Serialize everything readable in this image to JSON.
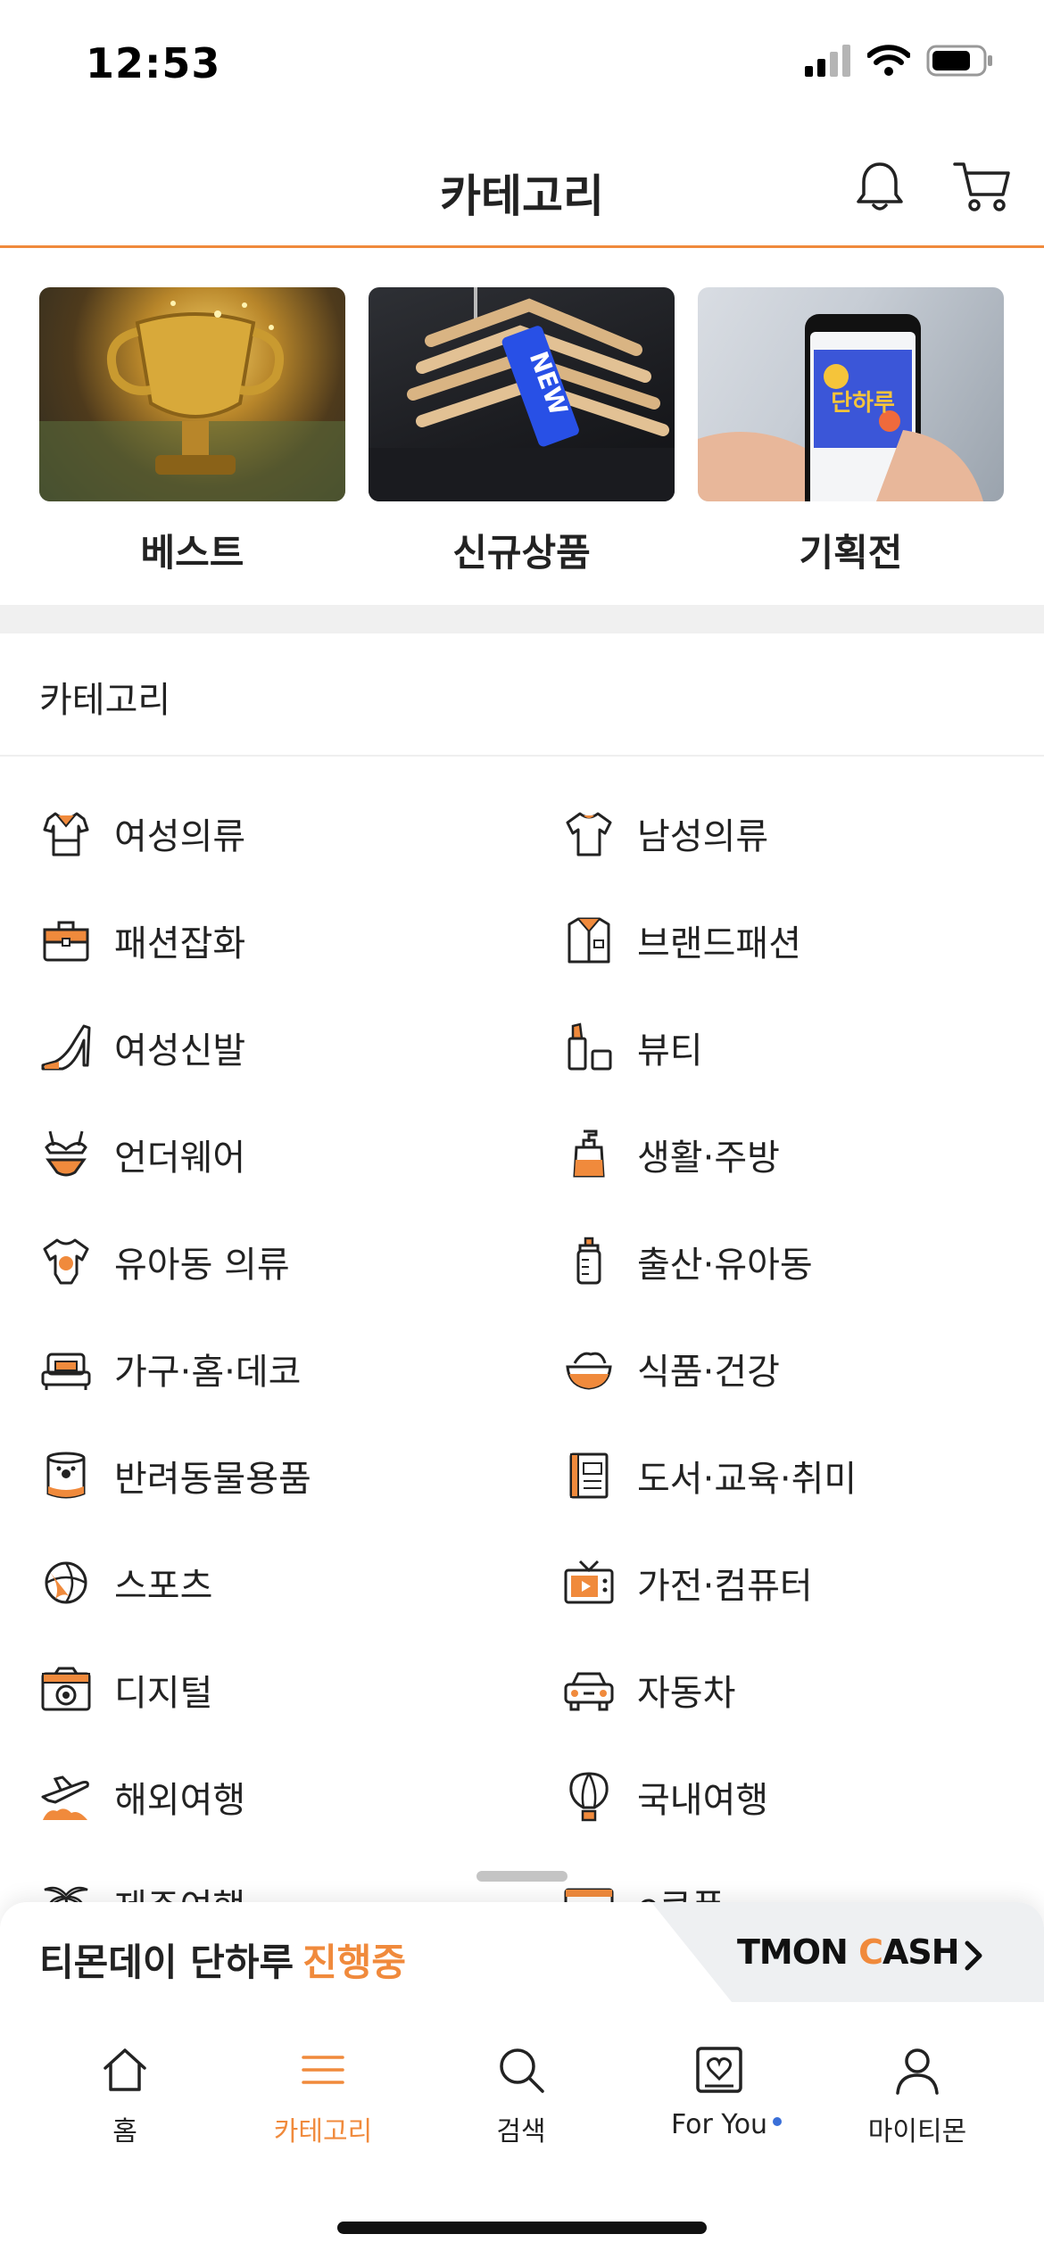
{
  "status_bar": {
    "time": "12:53"
  },
  "header": {
    "title": "카테고리"
  },
  "promos": [
    {
      "label": "베스트"
    },
    {
      "label": "신규상품",
      "tag_text": "NEW"
    },
    {
      "label": "기획전",
      "screen_text": "단하루"
    }
  ],
  "section": {
    "title": "카테고리"
  },
  "categories": [
    {
      "label": "여성의류",
      "icon": "blouse-icon"
    },
    {
      "label": "남성의류",
      "icon": "tshirt-icon"
    },
    {
      "label": "패션잡화",
      "icon": "bag-icon"
    },
    {
      "label": "브랜드패션",
      "icon": "shirt-icon"
    },
    {
      "label": "여성신발",
      "icon": "heel-icon"
    },
    {
      "label": "뷰티",
      "icon": "lipstick-icon"
    },
    {
      "label": "언더웨어",
      "icon": "lingerie-icon"
    },
    {
      "label": "생활·주방",
      "icon": "pump-bottle-icon"
    },
    {
      "label": "유아동 의류",
      "icon": "baby-onesie-icon"
    },
    {
      "label": "출산·유아동",
      "icon": "baby-bottle-icon"
    },
    {
      "label": "가구·홈·데코",
      "icon": "bed-icon"
    },
    {
      "label": "식품·건강",
      "icon": "food-bowl-icon"
    },
    {
      "label": "반려동물용품",
      "icon": "pet-food-can-icon"
    },
    {
      "label": "도서·교육·취미",
      "icon": "book-icon"
    },
    {
      "label": "스포츠",
      "icon": "basketball-icon"
    },
    {
      "label": "가전·컴퓨터",
      "icon": "tv-icon"
    },
    {
      "label": "디지털",
      "icon": "camera-icon"
    },
    {
      "label": "자동차",
      "icon": "car-icon"
    },
    {
      "label": "해외여행",
      "icon": "airplane-icon"
    },
    {
      "label": "국내여행",
      "icon": "hot-air-balloon-icon"
    },
    {
      "label": "제주여행",
      "icon": "palm-tree-icon"
    },
    {
      "label": "e쿠폰",
      "icon": "coupon-icon"
    }
  ],
  "bottom_sheet": {
    "promo_text": "티몬데이 단하루",
    "promo_highlight": "진행중",
    "cash_prefix": "TMON ",
    "cash_c": "C",
    "cash_suffix": "ASH"
  },
  "tabs": [
    {
      "label": "홈",
      "icon": "home-icon"
    },
    {
      "label": "카테고리",
      "icon": "menu-icon",
      "active": true
    },
    {
      "label": "검색",
      "icon": "search-icon"
    },
    {
      "label": "For You",
      "icon": "heart-frame-icon",
      "has_badge": true
    },
    {
      "label": "마이티몬",
      "icon": "person-icon"
    }
  ],
  "colors": {
    "accent": "#f08a3c",
    "text": "#222222",
    "band": "#f0f0f0",
    "badge": "#3a6fd8"
  }
}
